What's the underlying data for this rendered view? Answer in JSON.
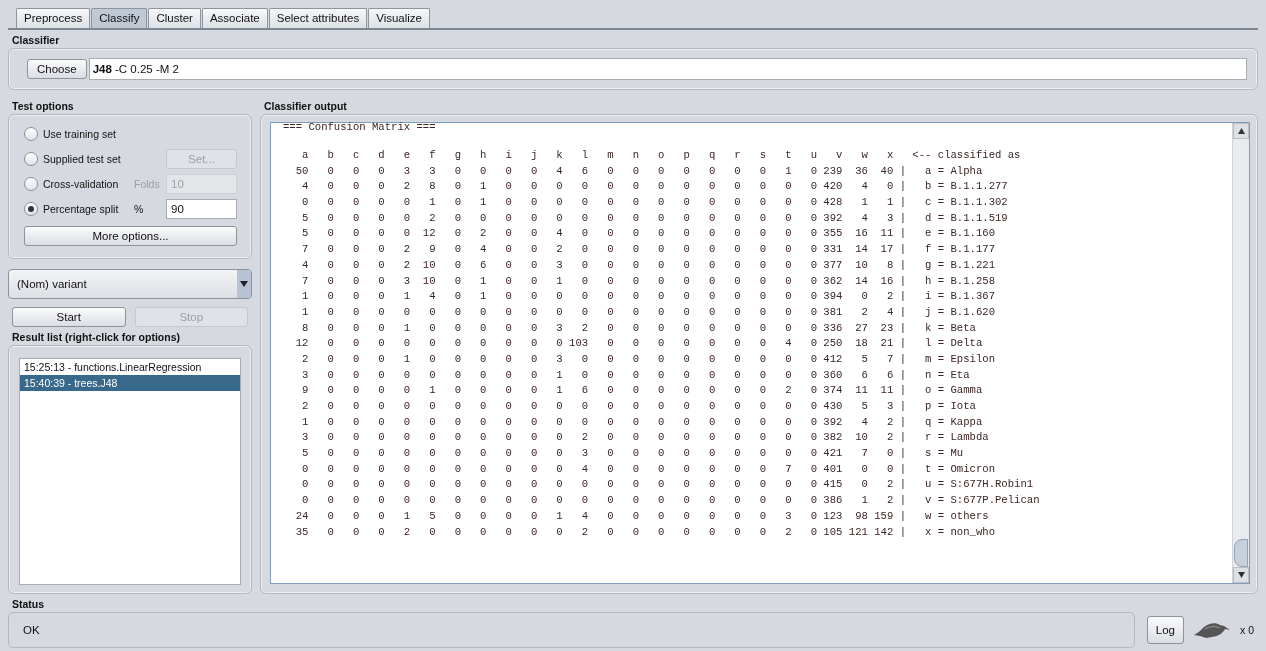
{
  "tabs": [
    {
      "label": "Preprocess",
      "selected": false
    },
    {
      "label": "Classify",
      "selected": true
    },
    {
      "label": "Cluster",
      "selected": false
    },
    {
      "label": "Associate",
      "selected": false
    },
    {
      "label": "Select attributes",
      "selected": false
    },
    {
      "label": "Visualize",
      "selected": false
    }
  ],
  "classifier": {
    "title": "Classifier",
    "button": "Choose",
    "value": "**J48** -C 0.25 -M 2"
  },
  "test_options": {
    "title": "Test options",
    "options": [
      {
        "label": "Use training set",
        "selected": false,
        "kind": "plain"
      },
      {
        "label": "Supplied test set",
        "selected": false,
        "kind": "button",
        "button": "Set...",
        "disabled": true
      },
      {
        "label": "Cross-validation",
        "selected": false,
        "kind": "field",
        "field_label": "Folds",
        "value": "10",
        "disabled": true
      },
      {
        "label": "Percentage split",
        "selected": true,
        "kind": "field",
        "field_label": "%",
        "value": "90",
        "disabled": false
      }
    ],
    "more_button": "More options..."
  },
  "class_select": {
    "value": "(Nom) variant"
  },
  "run_buttons": [
    {
      "label": "Start",
      "disabled": false
    },
    {
      "label": "Stop",
      "disabled": true
    }
  ],
  "result_list": {
    "title": "Result list (right-click for options)",
    "items": [
      {
        "label": "15:25:13 - functions.LinearRegression",
        "selected": false
      },
      {
        "label": "15:40:39 - trees.J48",
        "selected": true
      }
    ]
  },
  "output": {
    "title": "Classifier output",
    "heading": "=== Confusion Matrix ===",
    "header": {
      "cells": [
        "a",
        "b",
        "c",
        "d",
        "e",
        "f",
        "g",
        "h",
        "i",
        "j",
        "k",
        "l",
        "m",
        "n",
        "o",
        "p",
        "q",
        "r",
        "s",
        "t",
        "u",
        "v",
        "w",
        "x"
      ],
      "label": "<-- classified as"
    },
    "rows": [
      {
        "cells": [
          "50",
          "0",
          "0",
          "0",
          "3",
          "3",
          "0",
          "0",
          "0",
          "0",
          "4",
          "6",
          "0",
          "0",
          "0",
          "0",
          "0",
          "0",
          "0",
          "1",
          "0",
          "239",
          "36",
          "40"
        ],
        "sep": "|",
        "label": "a = Alpha"
      },
      {
        "cells": [
          "4",
          "0",
          "0",
          "0",
          "2",
          "8",
          "0",
          "1",
          "0",
          "0",
          "0",
          "0",
          "0",
          "0",
          "0",
          "0",
          "0",
          "0",
          "0",
          "0",
          "0",
          "420",
          "4",
          "0"
        ],
        "sep": "|",
        "label": "b = B.1.1.277"
      },
      {
        "cells": [
          "0",
          "0",
          "0",
          "0",
          "0",
          "1",
          "0",
          "1",
          "0",
          "0",
          "0",
          "0",
          "0",
          "0",
          "0",
          "0",
          "0",
          "0",
          "0",
          "0",
          "0",
          "428",
          "1",
          "1"
        ],
        "sep": "|",
        "label": "c = B.1.1.302"
      },
      {
        "cells": [
          "5",
          "0",
          "0",
          "0",
          "0",
          "2",
          "0",
          "0",
          "0",
          "0",
          "0",
          "0",
          "0",
          "0",
          "0",
          "0",
          "0",
          "0",
          "0",
          "0",
          "0",
          "392",
          "4",
          "3"
        ],
        "sep": "|",
        "label": "d = B.1.1.519"
      },
      {
        "cells": [
          "5",
          "0",
          "0",
          "0",
          "0",
          "12",
          "0",
          "2",
          "0",
          "0",
          "4",
          "0",
          "0",
          "0",
          "0",
          "0",
          "0",
          "0",
          "0",
          "0",
          "0",
          "355",
          "16",
          "11"
        ],
        "sep": "|",
        "label": "e = B.1.160"
      },
      {
        "cells": [
          "7",
          "0",
          "0",
          "0",
          "2",
          "9",
          "0",
          "4",
          "0",
          "0",
          "2",
          "0",
          "0",
          "0",
          "0",
          "0",
          "0",
          "0",
          "0",
          "0",
          "0",
          "331",
          "14",
          "17"
        ],
        "sep": "|",
        "label": "f = B.1.177"
      },
      {
        "cells": [
          "4",
          "0",
          "0",
          "0",
          "2",
          "10",
          "0",
          "6",
          "0",
          "0",
          "3",
          "0",
          "0",
          "0",
          "0",
          "0",
          "0",
          "0",
          "0",
          "0",
          "0",
          "377",
          "10",
          "8"
        ],
        "sep": "|",
        "label": "g = B.1.221"
      },
      {
        "cells": [
          "7",
          "0",
          "0",
          "0",
          "3",
          "10",
          "0",
          "1",
          "0",
          "0",
          "1",
          "0",
          "0",
          "0",
          "0",
          "0",
          "0",
          "0",
          "0",
          "0",
          "0",
          "362",
          "14",
          "16"
        ],
        "sep": "|",
        "label": "h = B.1.258"
      },
      {
        "cells": [
          "1",
          "0",
          "0",
          "0",
          "1",
          "4",
          "0",
          "1",
          "0",
          "0",
          "0",
          "0",
          "0",
          "0",
          "0",
          "0",
          "0",
          "0",
          "0",
          "0",
          "0",
          "394",
          "0",
          "2"
        ],
        "sep": "|",
        "label": "i = B.1.367"
      },
      {
        "cells": [
          "1",
          "0",
          "0",
          "0",
          "0",
          "0",
          "0",
          "0",
          "0",
          "0",
          "0",
          "0",
          "0",
          "0",
          "0",
          "0",
          "0",
          "0",
          "0",
          "0",
          "0",
          "381",
          "2",
          "4"
        ],
        "sep": "|",
        "label": "j = B.1.620"
      },
      {
        "cells": [
          "8",
          "0",
          "0",
          "0",
          "1",
          "0",
          "0",
          "0",
          "0",
          "0",
          "3",
          "2",
          "0",
          "0",
          "0",
          "0",
          "0",
          "0",
          "0",
          "0",
          "0",
          "336",
          "27",
          "23"
        ],
        "sep": "|",
        "label": "k = Beta"
      },
      {
        "cells": [
          "12",
          "0",
          "0",
          "0",
          "0",
          "0",
          "0",
          "0",
          "0",
          "0",
          "0",
          "103",
          "0",
          "0",
          "0",
          "0",
          "0",
          "0",
          "0",
          "4",
          "0",
          "250",
          "18",
          "21"
        ],
        "sep": "|",
        "label": "l = Delta"
      },
      {
        "cells": [
          "2",
          "0",
          "0",
          "0",
          "1",
          "0",
          "0",
          "0",
          "0",
          "0",
          "3",
          "0",
          "0",
          "0",
          "0",
          "0",
          "0",
          "0",
          "0",
          "0",
          "0",
          "412",
          "5",
          "7"
        ],
        "sep": "|",
        "label": "m = Epsilon"
      },
      {
        "cells": [
          "3",
          "0",
          "0",
          "0",
          "0",
          "0",
          "0",
          "0",
          "0",
          "0",
          "1",
          "0",
          "0",
          "0",
          "0",
          "0",
          "0",
          "0",
          "0",
          "0",
          "0",
          "360",
          "6",
          "6"
        ],
        "sep": "|",
        "label": "n = Eta"
      },
      {
        "cells": [
          "9",
          "0",
          "0",
          "0",
          "0",
          "1",
          "0",
          "0",
          "0",
          "0",
          "1",
          "6",
          "0",
          "0",
          "0",
          "0",
          "0",
          "0",
          "0",
          "2",
          "0",
          "374",
          "11",
          "11"
        ],
        "sep": "|",
        "label": "o = Gamma"
      },
      {
        "cells": [
          "2",
          "0",
          "0",
          "0",
          "0",
          "0",
          "0",
          "0",
          "0",
          "0",
          "0",
          "0",
          "0",
          "0",
          "0",
          "0",
          "0",
          "0",
          "0",
          "0",
          "0",
          "430",
          "5",
          "3"
        ],
        "sep": "|",
        "label": "p = Iota"
      },
      {
        "cells": [
          "1",
          "0",
          "0",
          "0",
          "0",
          "0",
          "0",
          "0",
          "0",
          "0",
          "0",
          "0",
          "0",
          "0",
          "0",
          "0",
          "0",
          "0",
          "0",
          "0",
          "0",
          "392",
          "4",
          "2"
        ],
        "sep": "|",
        "label": "q = Kappa"
      },
      {
        "cells": [
          "3",
          "0",
          "0",
          "0",
          "0",
          "0",
          "0",
          "0",
          "0",
          "0",
          "0",
          "2",
          "0",
          "0",
          "0",
          "0",
          "0",
          "0",
          "0",
          "0",
          "0",
          "382",
          "10",
          "2"
        ],
        "sep": "|",
        "label": "r = Lambda"
      },
      {
        "cells": [
          "5",
          "0",
          "0",
          "0",
          "0",
          "0",
          "0",
          "0",
          "0",
          "0",
          "0",
          "3",
          "0",
          "0",
          "0",
          "0",
          "0",
          "0",
          "0",
          "0",
          "0",
          "421",
          "7",
          "0"
        ],
        "sep": "|",
        "label": "s = Mu"
      },
      {
        "cells": [
          "0",
          "0",
          "0",
          "0",
          "0",
          "0",
          "0",
          "0",
          "0",
          "0",
          "0",
          "4",
          "0",
          "0",
          "0",
          "0",
          "0",
          "0",
          "0",
          "7",
          "0",
          "401",
          "0",
          "0"
        ],
        "sep": "|",
        "label": "t = Omicron"
      },
      {
        "cells": [
          "0",
          "0",
          "0",
          "0",
          "0",
          "0",
          "0",
          "0",
          "0",
          "0",
          "0",
          "0",
          "0",
          "0",
          "0",
          "0",
          "0",
          "0",
          "0",
          "0",
          "0",
          "415",
          "0",
          "2"
        ],
        "sep": "|",
        "label": "u = S:677H.Robin1"
      },
      {
        "cells": [
          "0",
          "0",
          "0",
          "0",
          "0",
          "0",
          "0",
          "0",
          "0",
          "0",
          "0",
          "0",
          "0",
          "0",
          "0",
          "0",
          "0",
          "0",
          "0",
          "0",
          "0",
          "386",
          "1",
          "2"
        ],
        "sep": "|",
        "label": "v = S:677P.Pelican"
      },
      {
        "cells": [
          "24",
          "0",
          "0",
          "0",
          "1",
          "5",
          "0",
          "0",
          "0",
          "0",
          "1",
          "4",
          "0",
          "0",
          "0",
          "0",
          "0",
          "0",
          "0",
          "3",
          "0",
          "123",
          "98",
          "159"
        ],
        "sep": "|",
        "label": "w = others"
      },
      {
        "cells": [
          "35",
          "0",
          "0",
          "0",
          "2",
          "0",
          "0",
          "0",
          "0",
          "0",
          "0",
          "2",
          "0",
          "0",
          "0",
          "0",
          "0",
          "0",
          "0",
          "2",
          "0",
          "105",
          "121",
          "142"
        ],
        "sep": "|",
        "label": "x = non_who"
      }
    ]
  },
  "status": {
    "title": "Status",
    "message": "OK",
    "log_button": "Log",
    "count": "x 0"
  }
}
